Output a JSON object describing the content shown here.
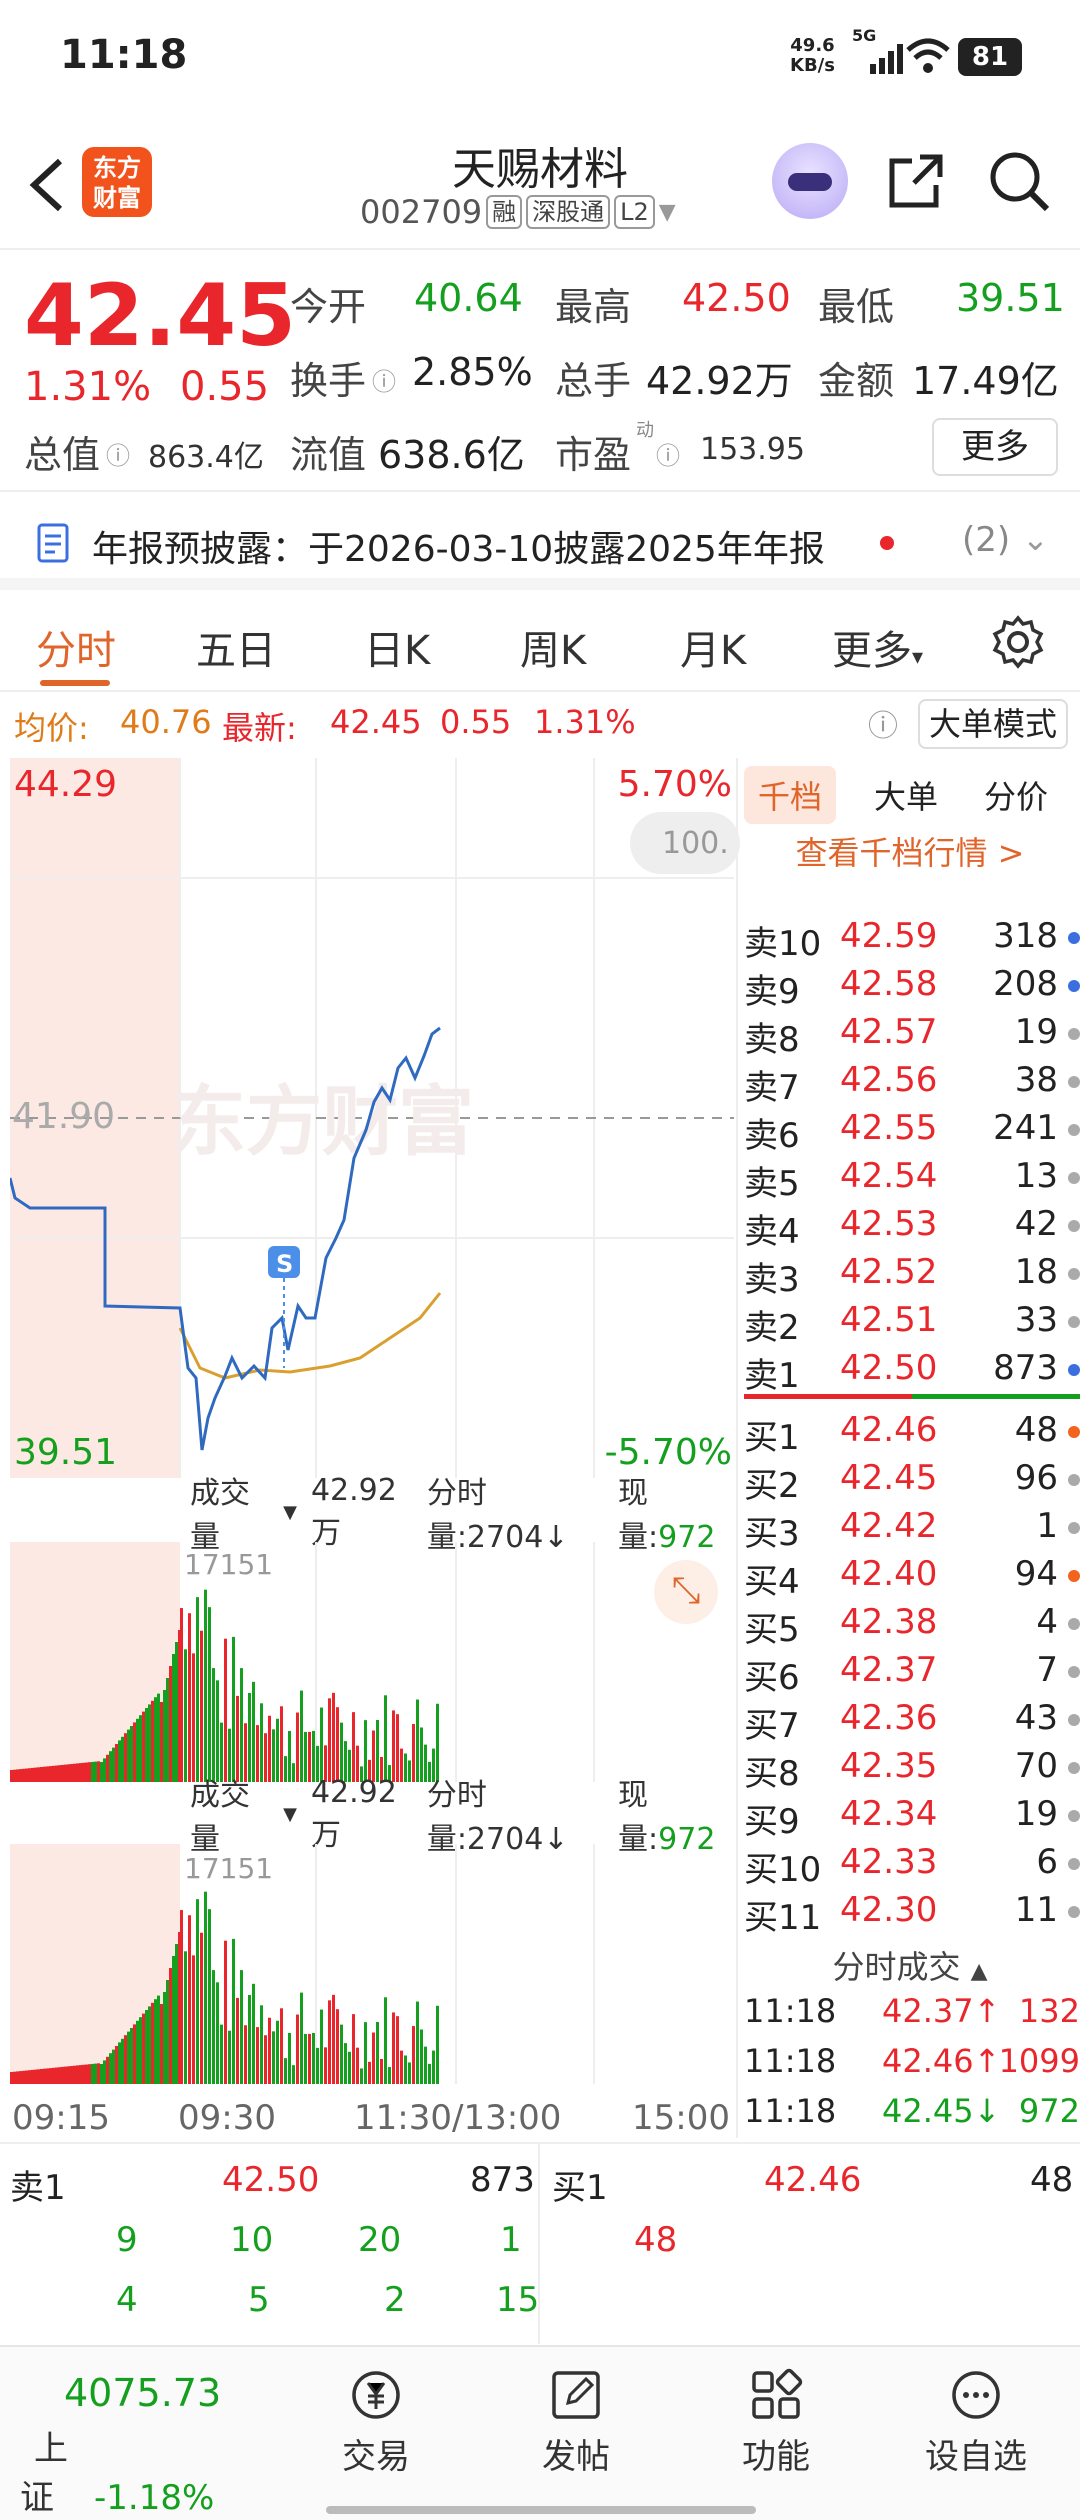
{
  "status_bar": {
    "time": "11:18",
    "net_speed": "49.6",
    "net_unit": "KB/s",
    "signal": "5G",
    "battery": "81"
  },
  "header": {
    "logo_text": "东方财富",
    "stock_name": "天赐材料",
    "stock_code": "002709",
    "tags": [
      "融",
      "深股通",
      "L2"
    ]
  },
  "quote": {
    "price": "42.45",
    "change_pct": "1.31%",
    "change": "0.55",
    "open_label": "今开",
    "open": "40.64",
    "high_label": "最高",
    "high": "42.50",
    "low_label": "最低",
    "low": "39.51",
    "turnover_label": "换手",
    "turnover": "2.85%",
    "volume_label": "总手",
    "volume": "42.92万",
    "amount_label": "金额",
    "amount": "17.49亿",
    "mktcap_label": "总值",
    "mktcap": "863.4亿",
    "float_label": "流值",
    "float_cap": "638.6亿",
    "pe_label": "市盈",
    "pe_sup": "动",
    "pe": "153.95",
    "more_button": "更多"
  },
  "notice": {
    "text": "年报预披露：于2026-03-10披露2025年年报",
    "count": "(2)"
  },
  "tabs": [
    "分时",
    "五日",
    "日K",
    "周K",
    "月K",
    "更多"
  ],
  "avg_bar": {
    "avg_label": "均价:",
    "avg": "40.76",
    "latest_label": "最新:",
    "latest": "42.45",
    "change": "0.55",
    "pct": "1.31%",
    "mode_button": "大单模式"
  },
  "chart": {
    "top_price": "44.29",
    "top_pct": "5.70%",
    "mid_price": "41.90",
    "bottom_price": "39.51",
    "bottom_pct": "-5.70%",
    "watermark": "东方财富",
    "pill": "100.",
    "signal_marker": "S"
  },
  "chart_data": {
    "type": "line",
    "title": "",
    "x_ticks": [
      "09:15",
      "09:30",
      "11:30/13:00",
      "15:00"
    ],
    "ylim": [
      39.51,
      44.29
    ],
    "prev_close": 41.9,
    "series": [],
    "volume_max_label": "17151"
  },
  "volume": {
    "label": "成交量",
    "total": "42.92万",
    "min_vol": "分时量:2704↓",
    "now_label": "现量:",
    "now": "972"
  },
  "book": {
    "tabs": [
      "千档",
      "大单",
      "分价"
    ],
    "view_link": "查看千档行情 >",
    "sells": [
      {
        "n": "卖10",
        "p": "42.59",
        "q": "318",
        "d": "blue"
      },
      {
        "n": "卖9",
        "p": "42.58",
        "q": "208",
        "d": "blue"
      },
      {
        "n": "卖8",
        "p": "42.57",
        "q": "19",
        "d": "gray"
      },
      {
        "n": "卖7",
        "p": "42.56",
        "q": "38",
        "d": "gray"
      },
      {
        "n": "卖6",
        "p": "42.55",
        "q": "241",
        "d": "gray"
      },
      {
        "n": "卖5",
        "p": "42.54",
        "q": "13",
        "d": "gray"
      },
      {
        "n": "卖4",
        "p": "42.53",
        "q": "42",
        "d": "gray"
      },
      {
        "n": "卖3",
        "p": "42.52",
        "q": "18",
        "d": "gray"
      },
      {
        "n": "卖2",
        "p": "42.51",
        "q": "33",
        "d": "gray"
      },
      {
        "n": "卖1",
        "p": "42.50",
        "q": "873",
        "d": "blue"
      }
    ],
    "buys": [
      {
        "n": "买1",
        "p": "42.46",
        "q": "48",
        "d": "orange"
      },
      {
        "n": "买2",
        "p": "42.45",
        "q": "96",
        "d": "gray"
      },
      {
        "n": "买3",
        "p": "42.42",
        "q": "1",
        "d": "gray"
      },
      {
        "n": "买4",
        "p": "42.40",
        "q": "94",
        "d": "orange"
      },
      {
        "n": "买5",
        "p": "42.38",
        "q": "4",
        "d": "gray"
      },
      {
        "n": "买6",
        "p": "42.37",
        "q": "7",
        "d": "gray"
      },
      {
        "n": "买7",
        "p": "42.36",
        "q": "43",
        "d": "gray"
      },
      {
        "n": "买8",
        "p": "42.35",
        "q": "70",
        "d": "gray"
      },
      {
        "n": "买9",
        "p": "42.34",
        "q": "19",
        "d": "gray"
      },
      {
        "n": "买10",
        "p": "42.33",
        "q": "6",
        "d": "gray"
      },
      {
        "n": "买11",
        "p": "42.30",
        "q": "11",
        "d": "gray"
      }
    ],
    "trades_title": "分时成交",
    "trades": [
      {
        "t": "11:18",
        "p": "42.37↑",
        "q": "132",
        "c": "red"
      },
      {
        "t": "11:18",
        "p": "42.46↑",
        "q": "1099",
        "c": "red"
      },
      {
        "t": "11:18",
        "p": "42.45↓",
        "q": "972",
        "c": "green"
      }
    ]
  },
  "bottom_queue": {
    "left_label": "卖1",
    "left_price": "42.50",
    "left_qty": "873",
    "right_label": "买1",
    "right_price": "42.46",
    "right_qty": "48",
    "left_row1": [
      "9",
      "10",
      "20",
      "1"
    ],
    "left_row2": [
      "4",
      "5",
      "2",
      "15"
    ],
    "right_row1": [
      "48"
    ]
  },
  "nav": {
    "index_value": "4075.73",
    "index_name": "上证",
    "index_pct": "-1.18%",
    "items": [
      "交易",
      "发帖",
      "功能",
      "设自选"
    ]
  }
}
